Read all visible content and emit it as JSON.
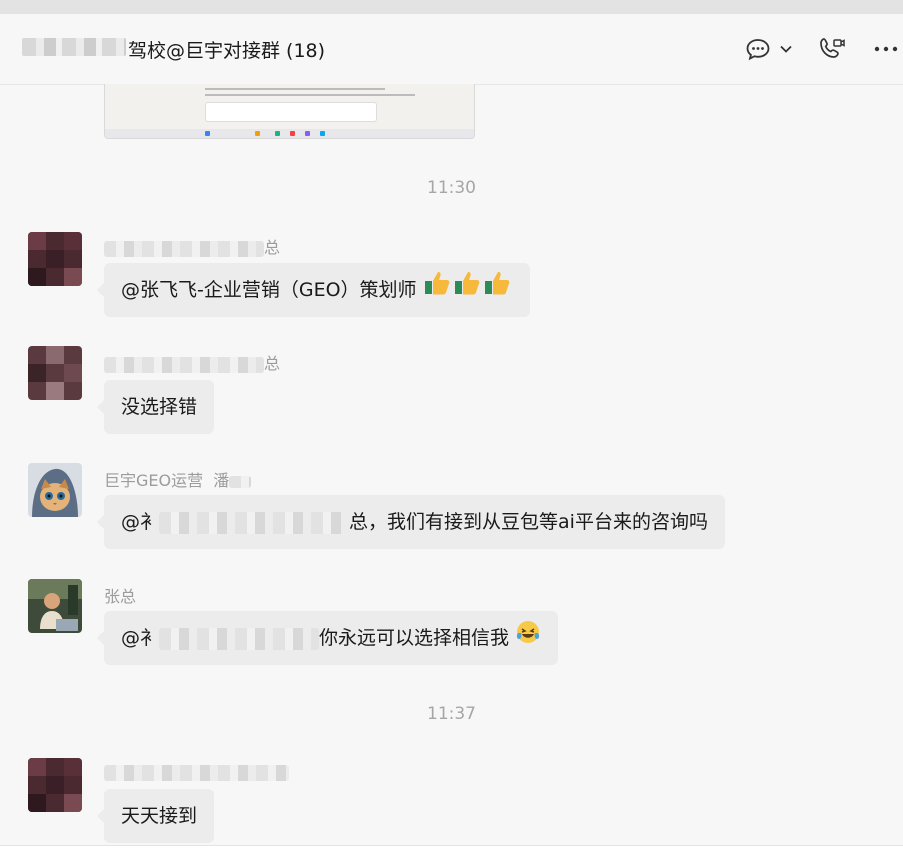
{
  "header": {
    "title": "驾校@巨宇对接群 (18)",
    "icons": [
      "chat-bubble-icon",
      "chevron-down-icon",
      "video-call-icon",
      "more-icon"
    ]
  },
  "times": [
    "11:30",
    "11:37"
  ],
  "messages": [
    {
      "sender_suffix": "总",
      "text": "@张飞飞-企业营销（GEO）策划师",
      "reaction": "thumbs-up x3"
    },
    {
      "sender_suffix": "总",
      "text": "没选择错"
    },
    {
      "sender_name": "巨宇GEO运营",
      "sender_extra": "潘",
      "prefix": "@衤",
      "text": "总，我们有接到从豆包等ai平台来的咨询吗"
    },
    {
      "sender_name": "张总",
      "prefix": "@衤",
      "text": "你永远可以选择相信我",
      "reaction": "laughing-crying"
    },
    {
      "text": "天天接到"
    }
  ],
  "colors": {
    "bubble": "#ececec",
    "background": "#f7f7f7",
    "time": "#a6a6a6",
    "sender": "#9c9c9c"
  }
}
